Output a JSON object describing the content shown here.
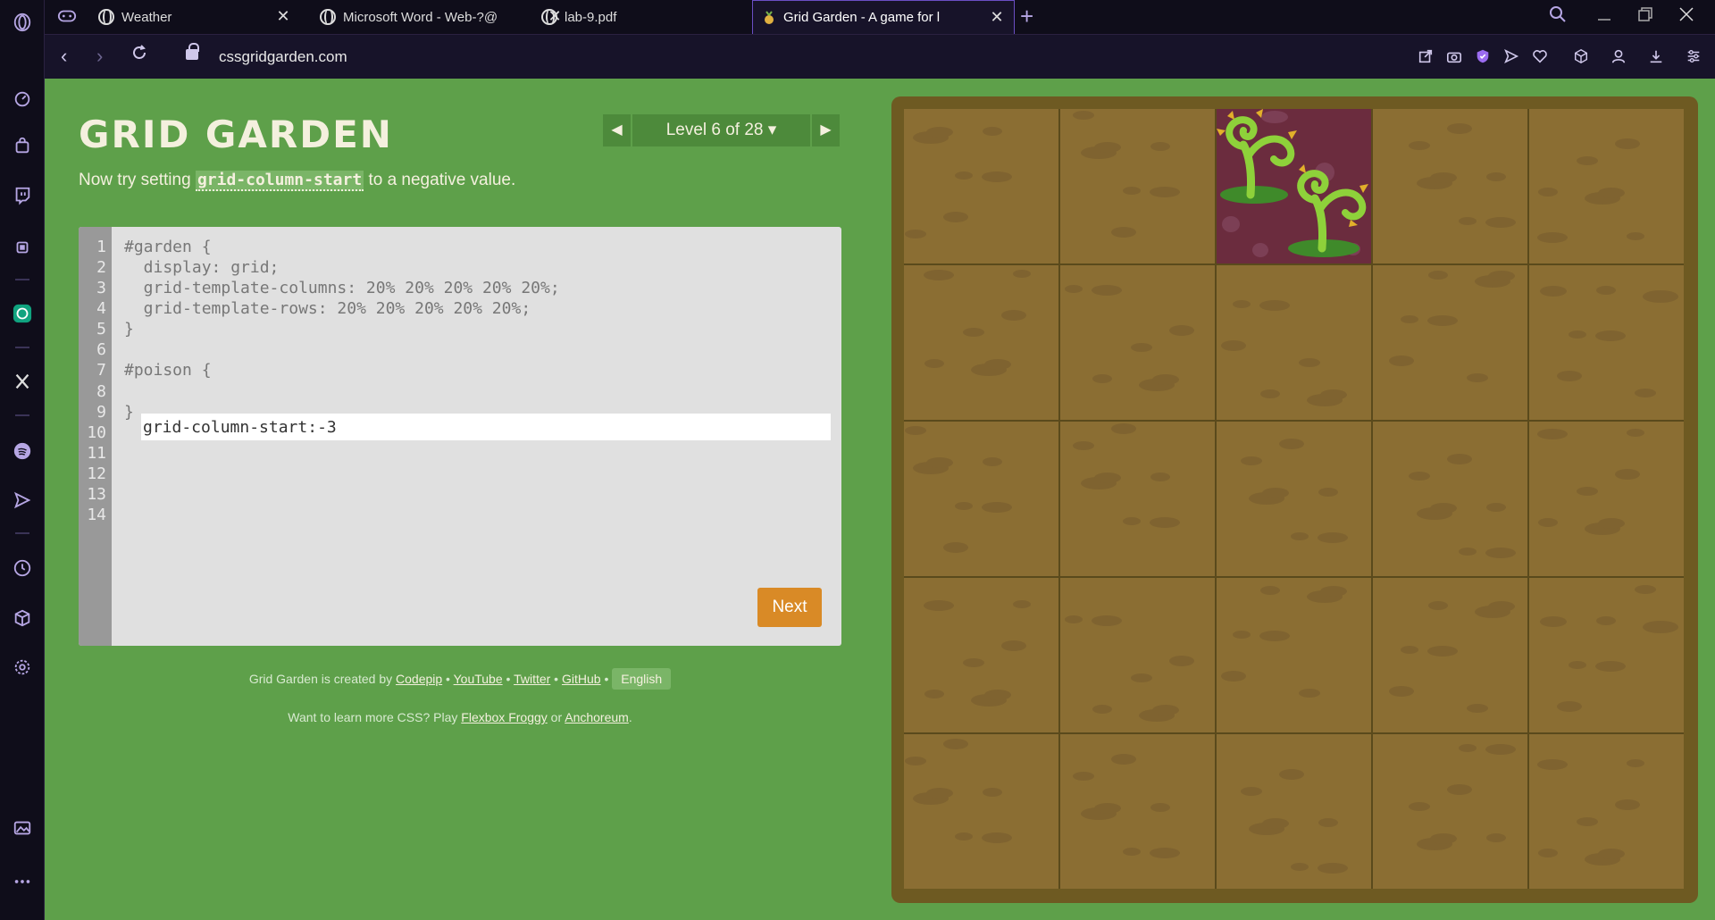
{
  "browser": {
    "tabs": [
      {
        "title": "Weather",
        "active": false
      },
      {
        "title": "Microsoft Word - Web-?@",
        "active": false
      },
      {
        "title": "lab-9.pdf",
        "active": false
      },
      {
        "title": "Grid Garden - A game for l",
        "active": true
      }
    ],
    "url": "cssgridgarden.com",
    "accent_color": "#6b4ec4"
  },
  "header": {
    "logo": "GRID GARDEN",
    "level_label": "Level 6 of 28 ▾",
    "prev_arrow": "◀",
    "next_arrow": "▶"
  },
  "instructions": {
    "before": "Now try setting ",
    "code": "grid-column-start",
    "after": " to a negative value."
  },
  "editor": {
    "line_numbers": [
      "1",
      "2",
      "3",
      "4",
      "5",
      "6",
      "7",
      "8",
      "9",
      "10",
      "11",
      "12",
      "13",
      "14"
    ],
    "lines": [
      "#garden {",
      "  display: grid;",
      "  grid-template-columns: 20% 20% 20% 20% 20%;",
      "  grid-template-rows: 20% 20% 20% 20% 20%;",
      "}",
      "",
      "#poison {",
      "",
      "}"
    ],
    "input_value": "grid-column-start:-3",
    "next_label": "Next",
    "next_color": "#d98a26"
  },
  "footer": {
    "created_by": "Grid Garden is created by ",
    "codepip": "Codepip",
    "sep": " • ",
    "youtube": "YouTube",
    "twitter": "Twitter",
    "github": "GitHub",
    "language": "English",
    "more_css_prefix": "Want to learn more CSS? Play ",
    "flexbox_froggy": "Flexbox Froggy",
    "or": " or ",
    "anchoreum": "Anchoreum",
    "period": "."
  },
  "garden": {
    "columns": 5,
    "rows": 5,
    "poison_column_start": -3
  },
  "colors": {
    "page_background": "#5ea04a",
    "soil": "#8b6e33",
    "poison": "#6b2c3e"
  }
}
